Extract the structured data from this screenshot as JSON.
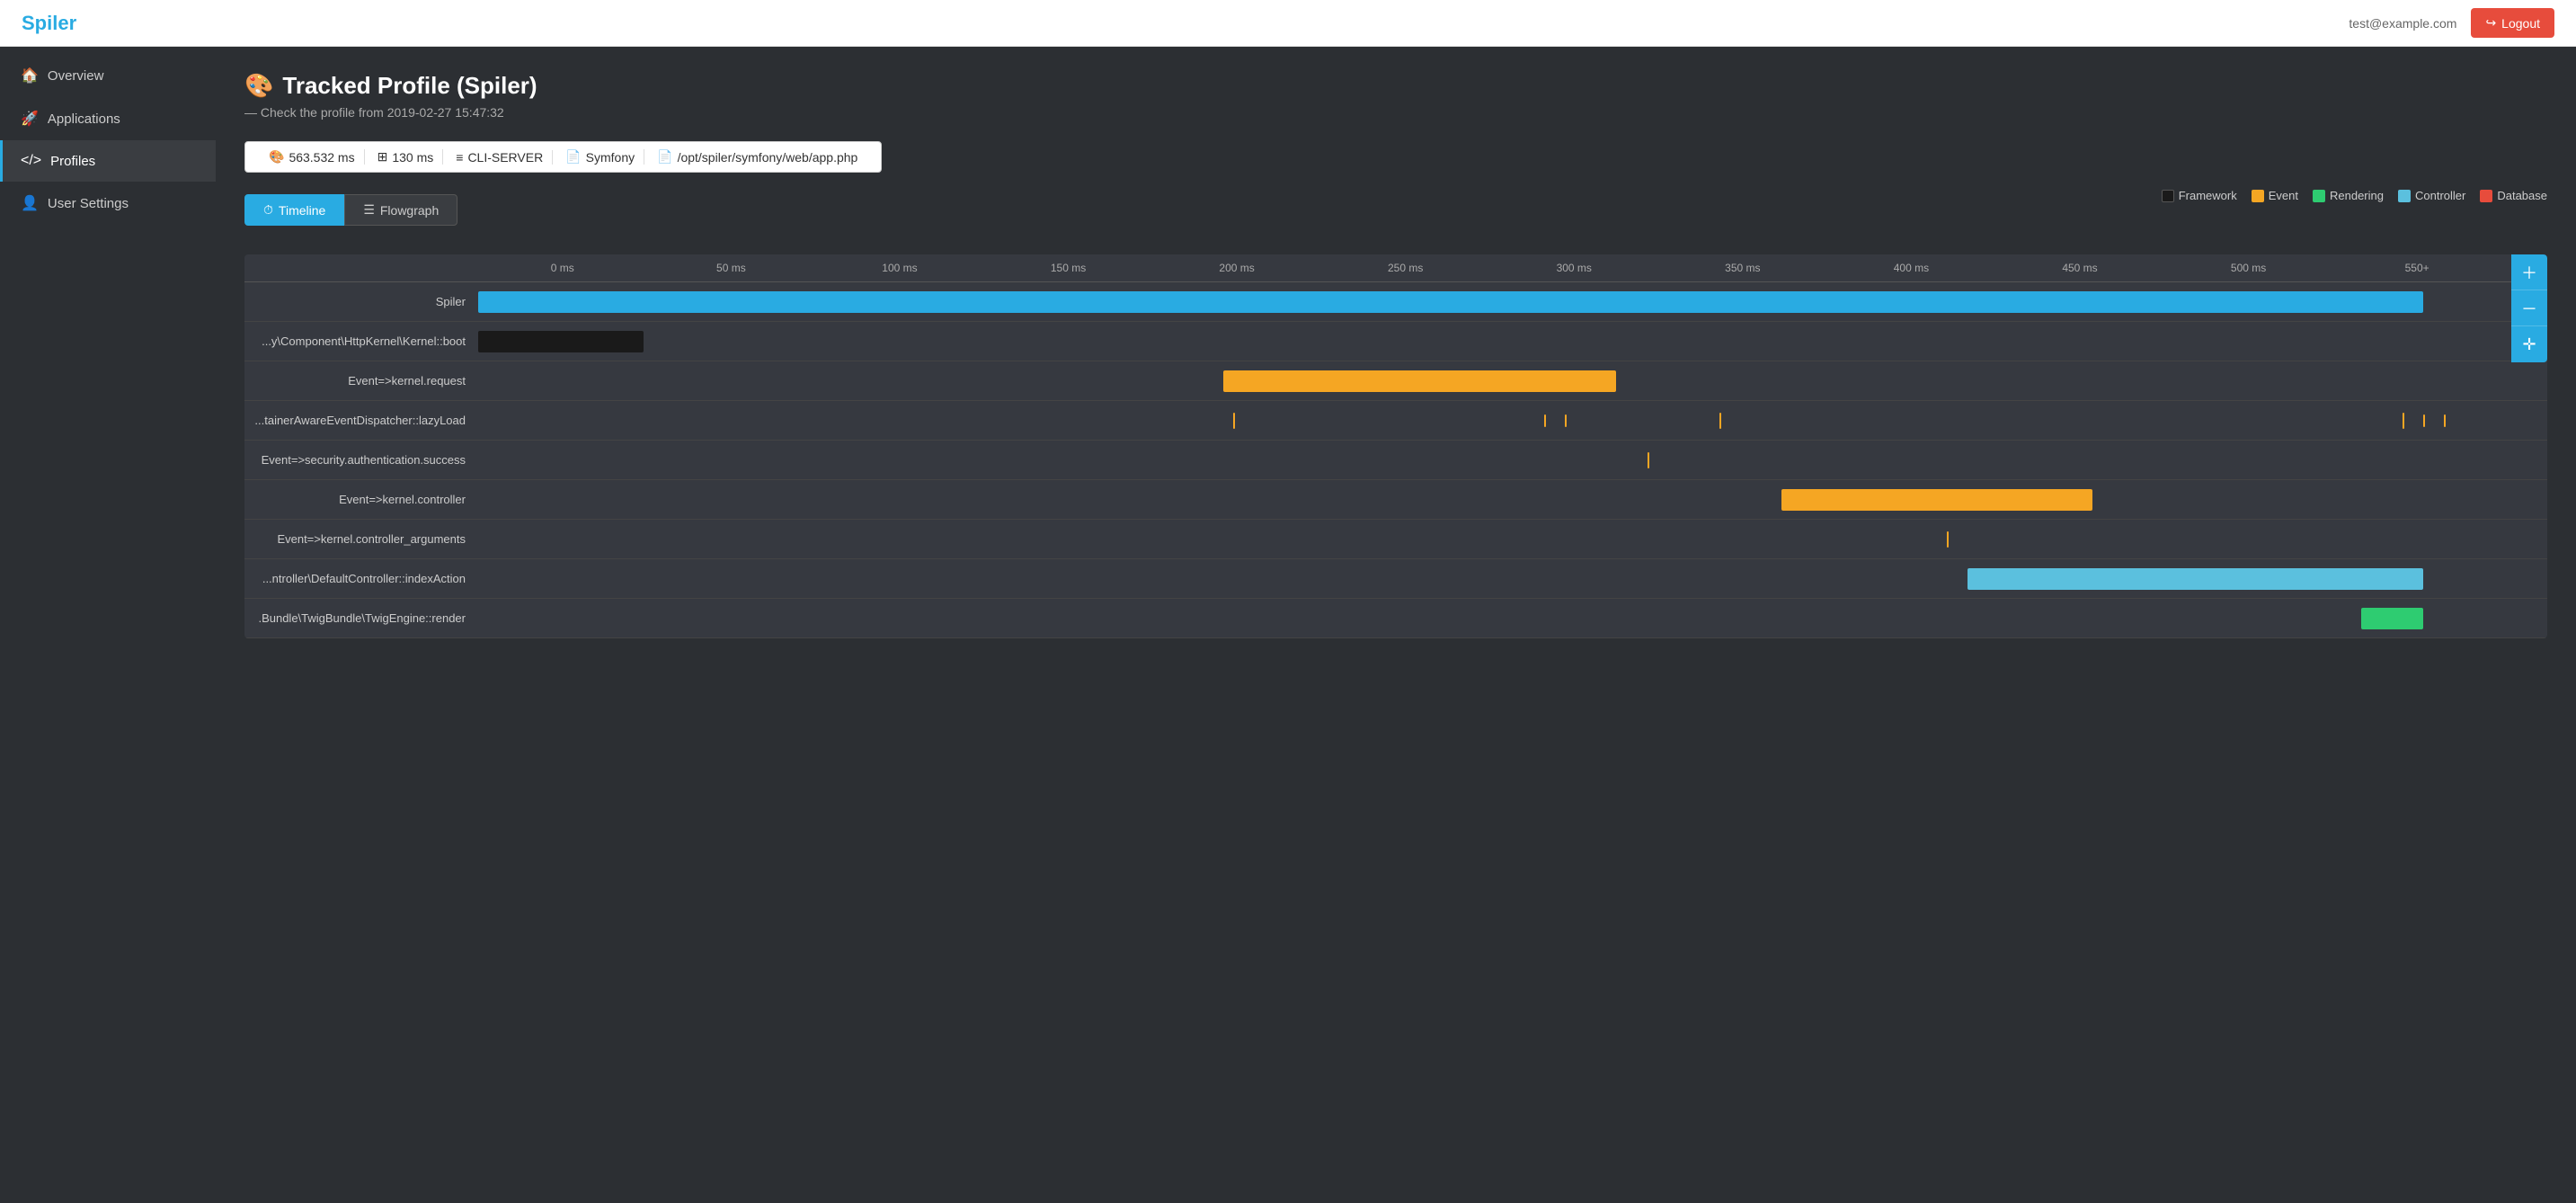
{
  "header": {
    "logo": "Spiler",
    "user_email": "test@example.com",
    "logout_label": "Logout"
  },
  "sidebar": {
    "items": [
      {
        "id": "overview",
        "label": "Overview",
        "icon": "🏠",
        "active": false
      },
      {
        "id": "applications",
        "label": "Applications",
        "icon": "🚀",
        "active": false
      },
      {
        "id": "profiles",
        "label": "Profiles",
        "icon": "</>",
        "active": true
      },
      {
        "id": "user-settings",
        "label": "User Settings",
        "icon": "👤",
        "active": false
      }
    ]
  },
  "main": {
    "page_title": "Tracked Profile (Spiler)",
    "page_title_icon": "🎨",
    "page_subtitle": "— Check the profile from 2019-02-27 15:47:32",
    "info_bar": {
      "duration": "563.532 ms",
      "memory": "130 ms",
      "server": "CLI-SERVER",
      "framework": "Symfony",
      "file": "/opt/spiler/symfony/web/app.php"
    },
    "tabs": [
      {
        "id": "timeline",
        "label": "Timeline",
        "icon": "⏱",
        "active": true
      },
      {
        "id": "flowgraph",
        "label": "Flowgraph",
        "icon": "☰",
        "active": false
      }
    ],
    "legend": [
      {
        "label": "Framework",
        "color": "#1a1a1a"
      },
      {
        "label": "Event",
        "color": "#f5a623"
      },
      {
        "label": "Rendering",
        "color": "#2ecc71"
      },
      {
        "label": "Controller",
        "color": "#5bc0de"
      },
      {
        "label": "Database",
        "color": "#e74c3c"
      }
    ],
    "time_axis": [
      "0 ms",
      "50 ms",
      "100 ms",
      "150 ms",
      "200 ms",
      "250 ms",
      "300 ms",
      "350 ms",
      "400 ms",
      "450 ms",
      "500 ms",
      "550+"
    ],
    "timeline_rows": [
      {
        "label": "Spiler",
        "bar": {
          "type": "blue",
          "left_pct": 0,
          "width_pct": 94
        }
      },
      {
        "label": "...y\\Component\\HttpKernel\\Kernel::boot",
        "bar": {
          "type": "black",
          "left_pct": 0,
          "width_pct": 8
        }
      },
      {
        "label": "Event=>kernel.request",
        "bar": {
          "type": "orange",
          "left_pct": 36,
          "width_pct": 19
        }
      },
      {
        "label": "...tainerAwareEventDispatcher::lazyLoad",
        "ticks": [
          {
            "left_pct": 36.5
          },
          {
            "left_pct": 51.5
          },
          {
            "left_pct": 52.5
          },
          {
            "left_pct": 60
          },
          {
            "left_pct": 93
          },
          {
            "left_pct": 94
          },
          {
            "left_pct": 95
          }
        ]
      },
      {
        "label": "Event=>security.authentication.success",
        "ticks": [
          {
            "left_pct": 56.5
          }
        ]
      },
      {
        "label": "Event=>kernel.controller",
        "bar": {
          "type": "orange",
          "left_pct": 63,
          "width_pct": 15
        }
      },
      {
        "label": "Event=>kernel.controller_arguments",
        "ticks": [
          {
            "left_pct": 71
          }
        ]
      },
      {
        "label": "...ntroller\\DefaultController::indexAction",
        "bar": {
          "type": "cyan",
          "left_pct": 72,
          "width_pct": 22
        }
      },
      {
        "label": ".Bundle\\TwigBundle\\TwigEngine::render",
        "bar": {
          "type": "green",
          "left_pct": 91,
          "width_pct": 3
        }
      }
    ]
  }
}
